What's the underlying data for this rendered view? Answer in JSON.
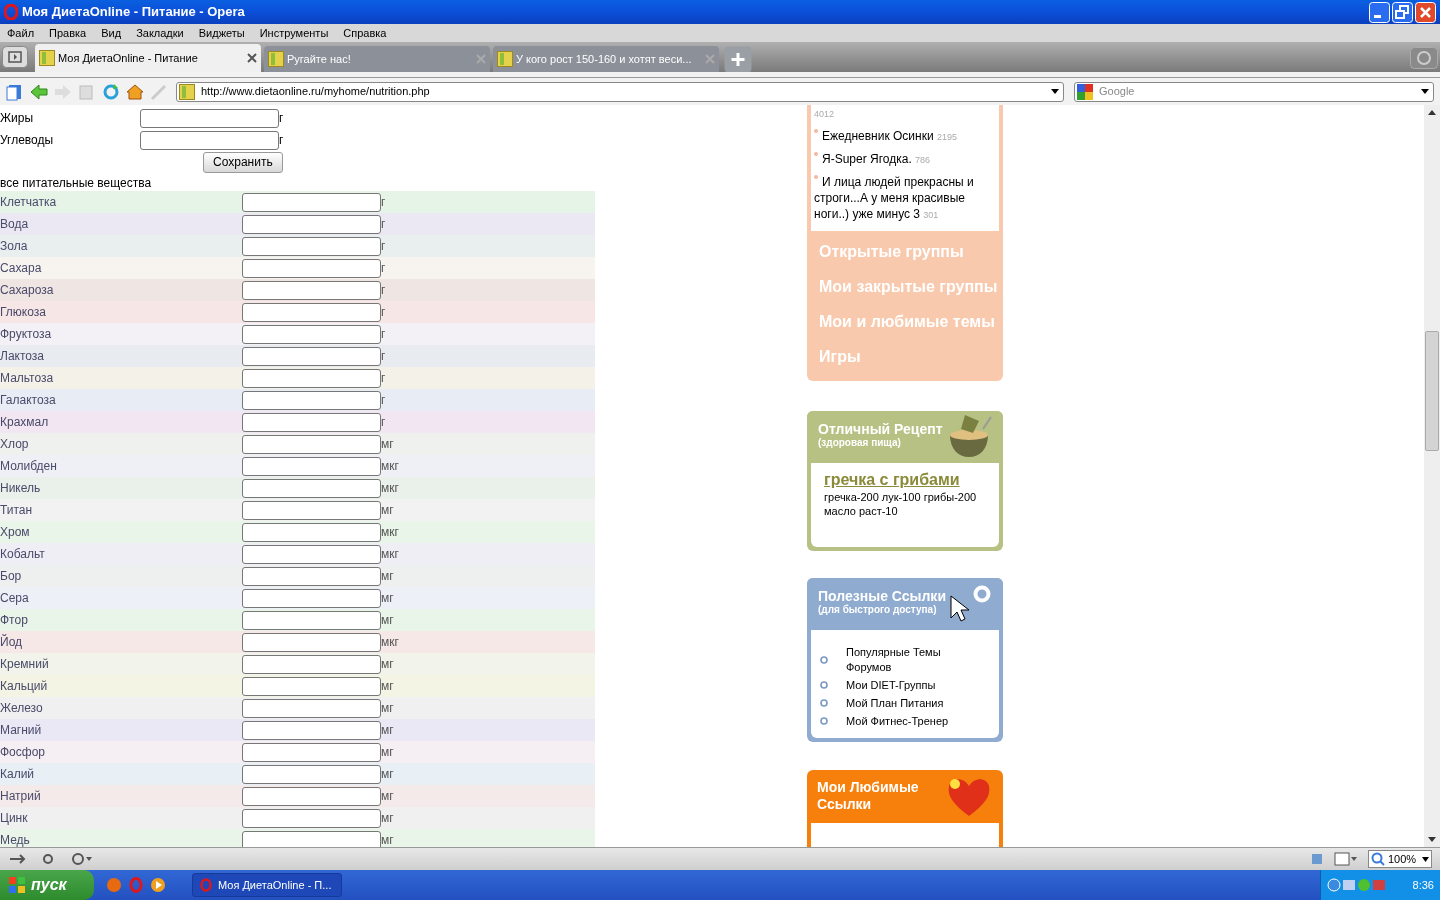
{
  "window": {
    "title": "Моя ДиетаOnline - Питание - Opera"
  },
  "menu": [
    "Файл",
    "Правка",
    "Вид",
    "Закладки",
    "Виджеты",
    "Инструменты",
    "Справка"
  ],
  "tabs": [
    {
      "label": "Моя ДиетаOnline - Питание",
      "selected": true
    },
    {
      "label": "Ругайте нас!",
      "selected": false
    },
    {
      "label": "У кого рост 150-160 и хотят веси...",
      "selected": false
    }
  ],
  "address": {
    "url": "http://www.dietaonline.ru/myhome/nutrition.php"
  },
  "search": {
    "placeholder": "Google"
  },
  "macro_form": {
    "rows": [
      {
        "label": "Жиры",
        "unit": "г"
      },
      {
        "label": "Углеводы",
        "unit": "г"
      }
    ],
    "save_button": "Сохранить"
  },
  "nutrients": {
    "heading": "все питательные вещества",
    "rows": [
      {
        "label": "Клетчатка",
        "unit": "г",
        "color": "#e6f4e8"
      },
      {
        "label": "Вода",
        "unit": "г",
        "color": "#ebe8f4"
      },
      {
        "label": "Зола",
        "unit": "г",
        "color": "#e9eeee"
      },
      {
        "label": "Сахара",
        "unit": "г",
        "color": "#f7f4f0"
      },
      {
        "label": "Сахароза",
        "unit": "г",
        "color": "#efe5e2"
      },
      {
        "label": "Глюкоза",
        "unit": "г",
        "color": "#f6e6e6"
      },
      {
        "label": "Фруктоза",
        "unit": "г",
        "color": "#f3f1f5"
      },
      {
        "label": "Лактоза",
        "unit": "г",
        "color": "#e8ecf0"
      },
      {
        "label": "Мальтоза",
        "unit": "г",
        "color": "#f3f1e8"
      },
      {
        "label": "Галактоза",
        "unit": "г",
        "color": "#e8ecf4"
      },
      {
        "label": "Крахмал",
        "unit": "г",
        "color": "#f1e6f1"
      },
      {
        "label": "Хлор",
        "unit": "мг",
        "color": "#eef1ee"
      },
      {
        "label": "Молибден",
        "unit": "мкг",
        "color": "#eef0f5"
      },
      {
        "label": "Никель",
        "unit": "мкг",
        "color": "#eaf1ea"
      },
      {
        "label": "Титан",
        "unit": "мг",
        "color": "#f2f2f2"
      },
      {
        "label": "Хром",
        "unit": "мкг",
        "color": "#e9f5e9"
      },
      {
        "label": "Кобальт",
        "unit": "мкг",
        "color": "#f0eef5"
      },
      {
        "label": "Бор",
        "unit": "мг",
        "color": "#eef0ef"
      },
      {
        "label": "Сера",
        "unit": "мг",
        "color": "#eef0f8"
      },
      {
        "label": "Фтор",
        "unit": "мг",
        "color": "#e8f5e8"
      },
      {
        "label": "Йод",
        "unit": "мкг",
        "color": "#f7e8e8"
      },
      {
        "label": "Кремний",
        "unit": "мг",
        "color": "#f2f3ea"
      },
      {
        "label": "Кальций",
        "unit": "мг",
        "color": "#f4f4e4"
      },
      {
        "label": "Железо",
        "unit": "мг",
        "color": "#f0f0f0"
      },
      {
        "label": "Магний",
        "unit": "мг",
        "color": "#ebe8f5"
      },
      {
        "label": "Фосфор",
        "unit": "мг",
        "color": "#f5eef2"
      },
      {
        "label": "Калий",
        "unit": "мг",
        "color": "#e8f0f5"
      },
      {
        "label": "Натрий",
        "unit": "мг",
        "color": "#f5eaea"
      },
      {
        "label": "Цинк",
        "unit": "мг",
        "color": "#f0f0f0"
      },
      {
        "label": "Медь",
        "unit": "мг",
        "color": "#e8f5e8"
      }
    ]
  },
  "sidebar": {
    "blog_items": [
      {
        "count": "4012"
      },
      {
        "text": "Ежедневник Осинки",
        "count": "2195"
      },
      {
        "text": "Я-Super Ягодка.",
        "count": "786"
      },
      {
        "text": "И лица людей прекрасны и строги...А у меня красивые ноги..) уже минус 3",
        "count": "301"
      }
    ],
    "group_links": [
      "Открытые группы",
      "Мои закрытые группы",
      "Мои и любимые темы",
      "Игры"
    ],
    "recipe": {
      "title": "Отличный Рецепт",
      "subtitle": "(здоровая пища)",
      "name": "гречка с грибами",
      "text": "гречка-200 лук-100 грибы-200 масло раст-10"
    },
    "useful_links": {
      "title": "Полезные Ссылки",
      "subtitle": "(для быстрого доступа)",
      "items": [
        "Популярные Темы Форумов",
        "Мои DIET-Группы",
        "Мой План Питания",
        "Мой Фитнес-Тренер"
      ]
    },
    "favorites": {
      "title": "Мои Любимые Ссылки"
    }
  },
  "status_bar": {
    "zoom": "100%"
  },
  "taskbar": {
    "start": "пуск",
    "windows": [
      {
        "label": "Моя ДиетаOnline - П..."
      }
    ],
    "clock": "8:36"
  }
}
